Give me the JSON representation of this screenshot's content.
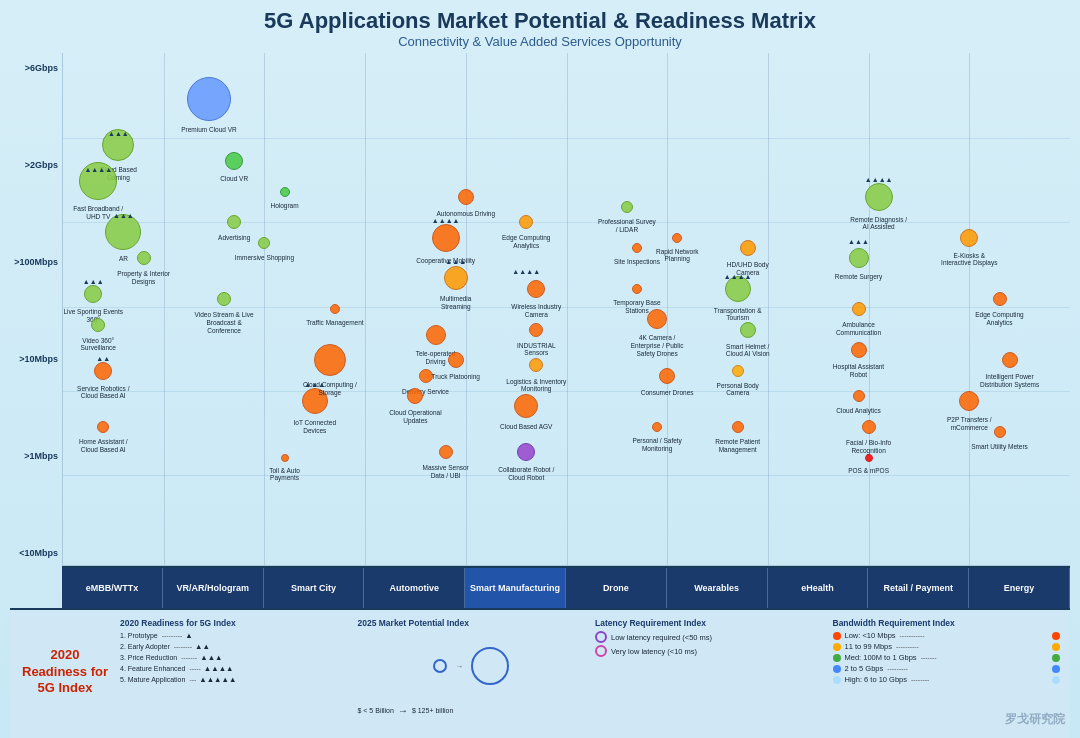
{
  "header": {
    "title": "5G Applications Market Potential & Readiness Matrix",
    "subtitle": "Connectivity & Value Added Services Opportunity"
  },
  "yAxis": {
    "labels": [
      ">6Gbps",
      ">2Gbps",
      ">100Mbps",
      ">10Mbps",
      ">1Mbps",
      "<10Mbps"
    ]
  },
  "categories": [
    {
      "id": "embb",
      "label": "eMBB/WTTx",
      "highlight": false
    },
    {
      "id": "vrar",
      "label": "VR/AR/Hologram",
      "highlight": false
    },
    {
      "id": "smartcity",
      "label": "Smart City",
      "highlight": false
    },
    {
      "id": "auto",
      "label": "Automotive",
      "highlight": false
    },
    {
      "id": "mfg",
      "label": "Smart Manufacturing",
      "highlight": true
    },
    {
      "id": "drone",
      "label": "Drone",
      "highlight": false
    },
    {
      "id": "wear",
      "label": "Wearables",
      "highlight": false
    },
    {
      "id": "ehealth",
      "label": "eHealth",
      "highlight": false
    },
    {
      "id": "retail",
      "label": "Retail / Payment",
      "highlight": false
    },
    {
      "id": "energy",
      "label": "Energy",
      "highlight": false
    }
  ],
  "legend": {
    "readiness_title": "2020 Readiness for 5G Index",
    "readiness_items": [
      {
        "level": 1,
        "label": "Prototype"
      },
      {
        "level": 2,
        "label": "Early Adopter"
      },
      {
        "level": 3,
        "label": "Price Reduction"
      },
      {
        "level": 4,
        "label": "Feature Enhanced"
      },
      {
        "level": 5,
        "label": "Mature Application"
      }
    ],
    "market_title": "2025 Market Potential Index",
    "market_desc": "$ < 5 Billion → $ 125+ billion",
    "latency_title": "Latency Requirement Index",
    "latency_items": [
      {
        "label": "Low latency required (<50 ms)",
        "color": "#8844cc"
      },
      {
        "label": "Very low latency (<10 ms)",
        "color": "#cc44aa"
      }
    ],
    "bandwidth_title": "Bandwidth Requirement Index",
    "bandwidth_items": [
      {
        "label": "Low: <10 Mbps",
        "color": "#ff4400"
      },
      {
        "label": "11 to 99 Mbps",
        "color": "#ffaa00"
      },
      {
        "label": "Med: 100M to 1 Gbps",
        "color": "#44aa44"
      },
      {
        "label": "2 to 5 Gbps",
        "color": "#4488ff"
      },
      {
        "label": "High: 6 to 10 Gbps",
        "color": "#aaddff"
      }
    ]
  },
  "bubbles": [
    {
      "id": "premium-cloud-vr",
      "label": "Premium Cloud VR",
      "x": 14.5,
      "y": 9,
      "size": 44,
      "color": "#6699ff",
      "border": "#3366cc"
    },
    {
      "id": "cloud-based-gaming",
      "label": "Cloud Based Gaming",
      "x": 5.5,
      "y": 18,
      "size": 32,
      "color": "#88cc44",
      "border": "#559911"
    },
    {
      "id": "cloud-vr",
      "label": "Cloud VR",
      "x": 17,
      "y": 21,
      "size": 18,
      "color": "#44cc44",
      "border": "#228822"
    },
    {
      "id": "fast-broadband",
      "label": "Fast Broadband / UHD TV",
      "x": 3.5,
      "y": 25,
      "size": 38,
      "color": "#88cc44",
      "border": "#559911"
    },
    {
      "id": "hologram",
      "label": "Hologram",
      "x": 22,
      "y": 27,
      "size": 10,
      "color": "#44cc44",
      "border": "#228822"
    },
    {
      "id": "ar",
      "label": "AR",
      "x": 6,
      "y": 35,
      "size": 36,
      "color": "#88cc44",
      "border": "#559911"
    },
    {
      "id": "advertising",
      "label": "Advertising",
      "x": 17,
      "y": 33,
      "size": 14,
      "color": "#88cc44",
      "border": "#559911"
    },
    {
      "id": "immersive-shopping",
      "label": "Immersive Shopping",
      "x": 20,
      "y": 37,
      "size": 12,
      "color": "#88cc44",
      "border": "#559911"
    },
    {
      "id": "property",
      "label": "Property & Interior Designs",
      "x": 8,
      "y": 40,
      "size": 14,
      "color": "#88cc44",
      "border": "#559911"
    },
    {
      "id": "live-sporting",
      "label": "Live Sporting Events 360°",
      "x": 3,
      "y": 47,
      "size": 18,
      "color": "#88cc44",
      "border": "#559911"
    },
    {
      "id": "video360",
      "label": "Video 360° Surveillance",
      "x": 3.5,
      "y": 53,
      "size": 14,
      "color": "#88cc44",
      "border": "#559911"
    },
    {
      "id": "video-stream",
      "label": "Video Stream & Live Broadcast & Conference",
      "x": 16,
      "y": 48,
      "size": 14,
      "color": "#88cc44",
      "border": "#559911"
    },
    {
      "id": "traffic-mgmt",
      "label": "Traffic Management",
      "x": 27,
      "y": 50,
      "size": 10,
      "color": "#ff6600",
      "border": "#cc4400"
    },
    {
      "id": "service-robotics",
      "label": "Service Robotics / Cloud Based AI",
      "x": 4,
      "y": 62,
      "size": 18,
      "color": "#ff6600",
      "border": "#cc4400"
    },
    {
      "id": "home-assistant",
      "label": "Home Assistant / Cloud Based AI",
      "x": 4,
      "y": 73,
      "size": 12,
      "color": "#ff6600",
      "border": "#cc4400"
    },
    {
      "id": "iot-connected",
      "label": "IoT Connected Devices",
      "x": 25,
      "y": 68,
      "size": 26,
      "color": "#ff6600",
      "border": "#cc4400"
    },
    {
      "id": "cloud-computing",
      "label": "Cloud Computing / Storage",
      "x": 26.5,
      "y": 60,
      "size": 32,
      "color": "#ff6600",
      "border": "#cc4400"
    },
    {
      "id": "toll-auto",
      "label": "Toll & Auto Payments",
      "x": 22,
      "y": 79,
      "size": 8,
      "color": "#ff6600",
      "border": "#cc4400"
    },
    {
      "id": "autonomous-driving",
      "label": "Autonomous Driving",
      "x": 40,
      "y": 28,
      "size": 16,
      "color": "#ff6600",
      "border": "#cc4400"
    },
    {
      "id": "cooperative-mobility",
      "label": "Cooperative Mobility",
      "x": 38,
      "y": 36,
      "size": 28,
      "color": "#ff6600",
      "border": "#cc4400"
    },
    {
      "id": "multimedia-streaming",
      "label": "Multimedia Streaming",
      "x": 39,
      "y": 44,
      "size": 24,
      "color": "#ff9900",
      "border": "#cc6600"
    },
    {
      "id": "tele-operated",
      "label": "Tele-operated Driving",
      "x": 37,
      "y": 55,
      "size": 20,
      "color": "#ff6600",
      "border": "#cc4400"
    },
    {
      "id": "delivery-service",
      "label": "Delivery Service",
      "x": 36,
      "y": 63,
      "size": 14,
      "color": "#ff6600",
      "border": "#cc4400"
    },
    {
      "id": "truck-platooning",
      "label": "Truck Platooning",
      "x": 39,
      "y": 60,
      "size": 16,
      "color": "#ff6600",
      "border": "#cc4400"
    },
    {
      "id": "cloud-op-updates",
      "label": "Cloud Operational Updates",
      "x": 35,
      "y": 67,
      "size": 16,
      "color": "#ff6600",
      "border": "#cc4400"
    },
    {
      "id": "massive-sensor",
      "label": "Massive Sensor Data / UBI",
      "x": 38,
      "y": 78,
      "size": 14,
      "color": "#ff6600",
      "border": "#cc4400"
    },
    {
      "id": "edge-computing",
      "label": "Edge Computing Analytics",
      "x": 46,
      "y": 33,
      "size": 14,
      "color": "#ff9900",
      "border": "#cc6600"
    },
    {
      "id": "wireless-industry",
      "label": "Wireless Industry Camera",
      "x": 47,
      "y": 46,
      "size": 18,
      "color": "#ff6600",
      "border": "#cc4400"
    },
    {
      "id": "industrial-sensors",
      "label": "INDUSTRIAL Sensors",
      "x": 47,
      "y": 54,
      "size": 14,
      "color": "#ff6600",
      "border": "#cc4400"
    },
    {
      "id": "logistics",
      "label": "Logistics & Inventory Monitoring",
      "x": 47,
      "y": 61,
      "size": 14,
      "color": "#ff9900",
      "border": "#cc6600"
    },
    {
      "id": "cloud-agv",
      "label": "Cloud Based AGV",
      "x": 46,
      "y": 69,
      "size": 24,
      "color": "#ff6600",
      "border": "#cc4400"
    },
    {
      "id": "collaborate-robot",
      "label": "Collaborate Robot / Cloud Robot",
      "x": 46,
      "y": 78,
      "size": 18,
      "color": "#9944cc",
      "border": "#6622aa"
    },
    {
      "id": "professional-survey",
      "label": "Professional Survey / LiDAR",
      "x": 56,
      "y": 30,
      "size": 12,
      "color": "#88cc44",
      "border": "#559911"
    },
    {
      "id": "site-inspections",
      "label": "Site Inspections",
      "x": 57,
      "y": 38,
      "size": 10,
      "color": "#ff6600",
      "border": "#cc4400"
    },
    {
      "id": "rapid-network",
      "label": "Rapid Network Planning",
      "x": 61,
      "y": 36,
      "size": 10,
      "color": "#ff6600",
      "border": "#cc4400"
    },
    {
      "id": "temp-base-stations",
      "label": "Temporary Base Stations",
      "x": 57,
      "y": 46,
      "size": 10,
      "color": "#ff6600",
      "border": "#cc4400"
    },
    {
      "id": "4k-camera",
      "label": "4K Camera / Enterprise / Public Safety Drones",
      "x": 59,
      "y": 52,
      "size": 20,
      "color": "#ff6600",
      "border": "#cc4400"
    },
    {
      "id": "consumer-drones",
      "label": "Consumer Drones",
      "x": 60,
      "y": 63,
      "size": 16,
      "color": "#ff6600",
      "border": "#cc4400"
    },
    {
      "id": "personal-safety",
      "label": "Personal / Safety Monitoring",
      "x": 59,
      "y": 73,
      "size": 10,
      "color": "#ff6600",
      "border": "#cc4400"
    },
    {
      "id": "hd-uhd-body",
      "label": "HD/UHD Body Camera",
      "x": 68,
      "y": 38,
      "size": 16,
      "color": "#ff9900",
      "border": "#cc6600"
    },
    {
      "id": "transport-tourism",
      "label": "Transportation & Tourism",
      "x": 67,
      "y": 46,
      "size": 26,
      "color": "#88cc44",
      "border": "#559911"
    },
    {
      "id": "smart-helmet",
      "label": "Smart Helmet / Cloud AI Vision",
      "x": 68,
      "y": 54,
      "size": 16,
      "color": "#88cc44",
      "border": "#559911"
    },
    {
      "id": "personal-body-cam",
      "label": "Personal Body Camera",
      "x": 67,
      "y": 62,
      "size": 12,
      "color": "#ffaa00",
      "border": "#cc7700"
    },
    {
      "id": "remote-patient",
      "label": "Remote Patient Management",
      "x": 67,
      "y": 73,
      "size": 12,
      "color": "#ff6600",
      "border": "#cc4400"
    },
    {
      "id": "remote-diagnosis",
      "label": "Remote Diagnosis / AI Assisted",
      "x": 81,
      "y": 28,
      "size": 28,
      "color": "#88cc44",
      "border": "#559911"
    },
    {
      "id": "remote-surgery",
      "label": "Remote Surgery",
      "x": 79,
      "y": 40,
      "size": 20,
      "color": "#88cc44",
      "border": "#559911"
    },
    {
      "id": "ambulance-comm",
      "label": "Ambulance Communication",
      "x": 79,
      "y": 50,
      "size": 14,
      "color": "#ff9900",
      "border": "#cc6600"
    },
    {
      "id": "hospital-assistant",
      "label": "Hospital Assistant Robot",
      "x": 79,
      "y": 58,
      "size": 16,
      "color": "#ff6600",
      "border": "#cc4400"
    },
    {
      "id": "cloud-analytics",
      "label": "Cloud Analytics",
      "x": 79,
      "y": 67,
      "size": 12,
      "color": "#ff6600",
      "border": "#cc4400"
    },
    {
      "id": "facial-bio",
      "label": "Facial / Bio-Info Recognition",
      "x": 80,
      "y": 73,
      "size": 14,
      "color": "#ff6600",
      "border": "#cc4400"
    },
    {
      "id": "pos-mpos",
      "label": "POS & mPOS",
      "x": 80,
      "y": 79,
      "size": 8,
      "color": "#ff0000",
      "border": "#cc0000"
    },
    {
      "id": "ekiosks",
      "label": "E-Kiosks & Interactive Displays",
      "x": 90,
      "y": 36,
      "size": 18,
      "color": "#ff9900",
      "border": "#cc6600"
    },
    {
      "id": "p2p-transfers",
      "label": "P2P Transfers / mCommerce",
      "x": 90,
      "y": 68,
      "size": 20,
      "color": "#ff6600",
      "border": "#cc4400"
    },
    {
      "id": "edge-computing-energy",
      "label": "Edge Computing Analytics",
      "x": 93,
      "y": 48,
      "size": 14,
      "color": "#ff6600",
      "border": "#cc4400"
    },
    {
      "id": "intelligent-power",
      "label": "Intelligent Power Distribution Systems",
      "x": 94,
      "y": 60,
      "size": 16,
      "color": "#ff6600",
      "border": "#cc4400"
    },
    {
      "id": "smart-utility",
      "label": "Smart Utility Meters",
      "x": 93,
      "y": 74,
      "size": 12,
      "color": "#ff6600",
      "border": "#cc4400"
    }
  ]
}
